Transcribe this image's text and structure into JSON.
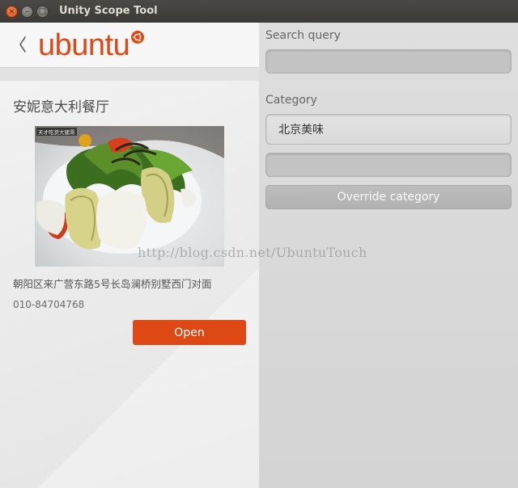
{
  "window": {
    "title": "Unity Scope Tool",
    "close_glyph": "×",
    "min_glyph": "–",
    "max_glyph": "□"
  },
  "header": {
    "logo_text": "ubuntu",
    "brand_color": "#dd4814",
    "back_icon": "chevron-left-icon"
  },
  "preview": {
    "title": "安妮意大利餐厅",
    "image_overlay_text": "天才吃货大猪哥",
    "address": "朝阳区来广营东路5号长岛澜桥别墅西门对面",
    "phone": "010-84704768",
    "open_label": "Open"
  },
  "watermark": "http://blog.csdn.net/UbuntuTouch",
  "controls": {
    "search_label": "Search query",
    "search_value": "",
    "category_label": "Category",
    "category_value": "北京美味",
    "override_value": "",
    "override_label": "Override category"
  }
}
